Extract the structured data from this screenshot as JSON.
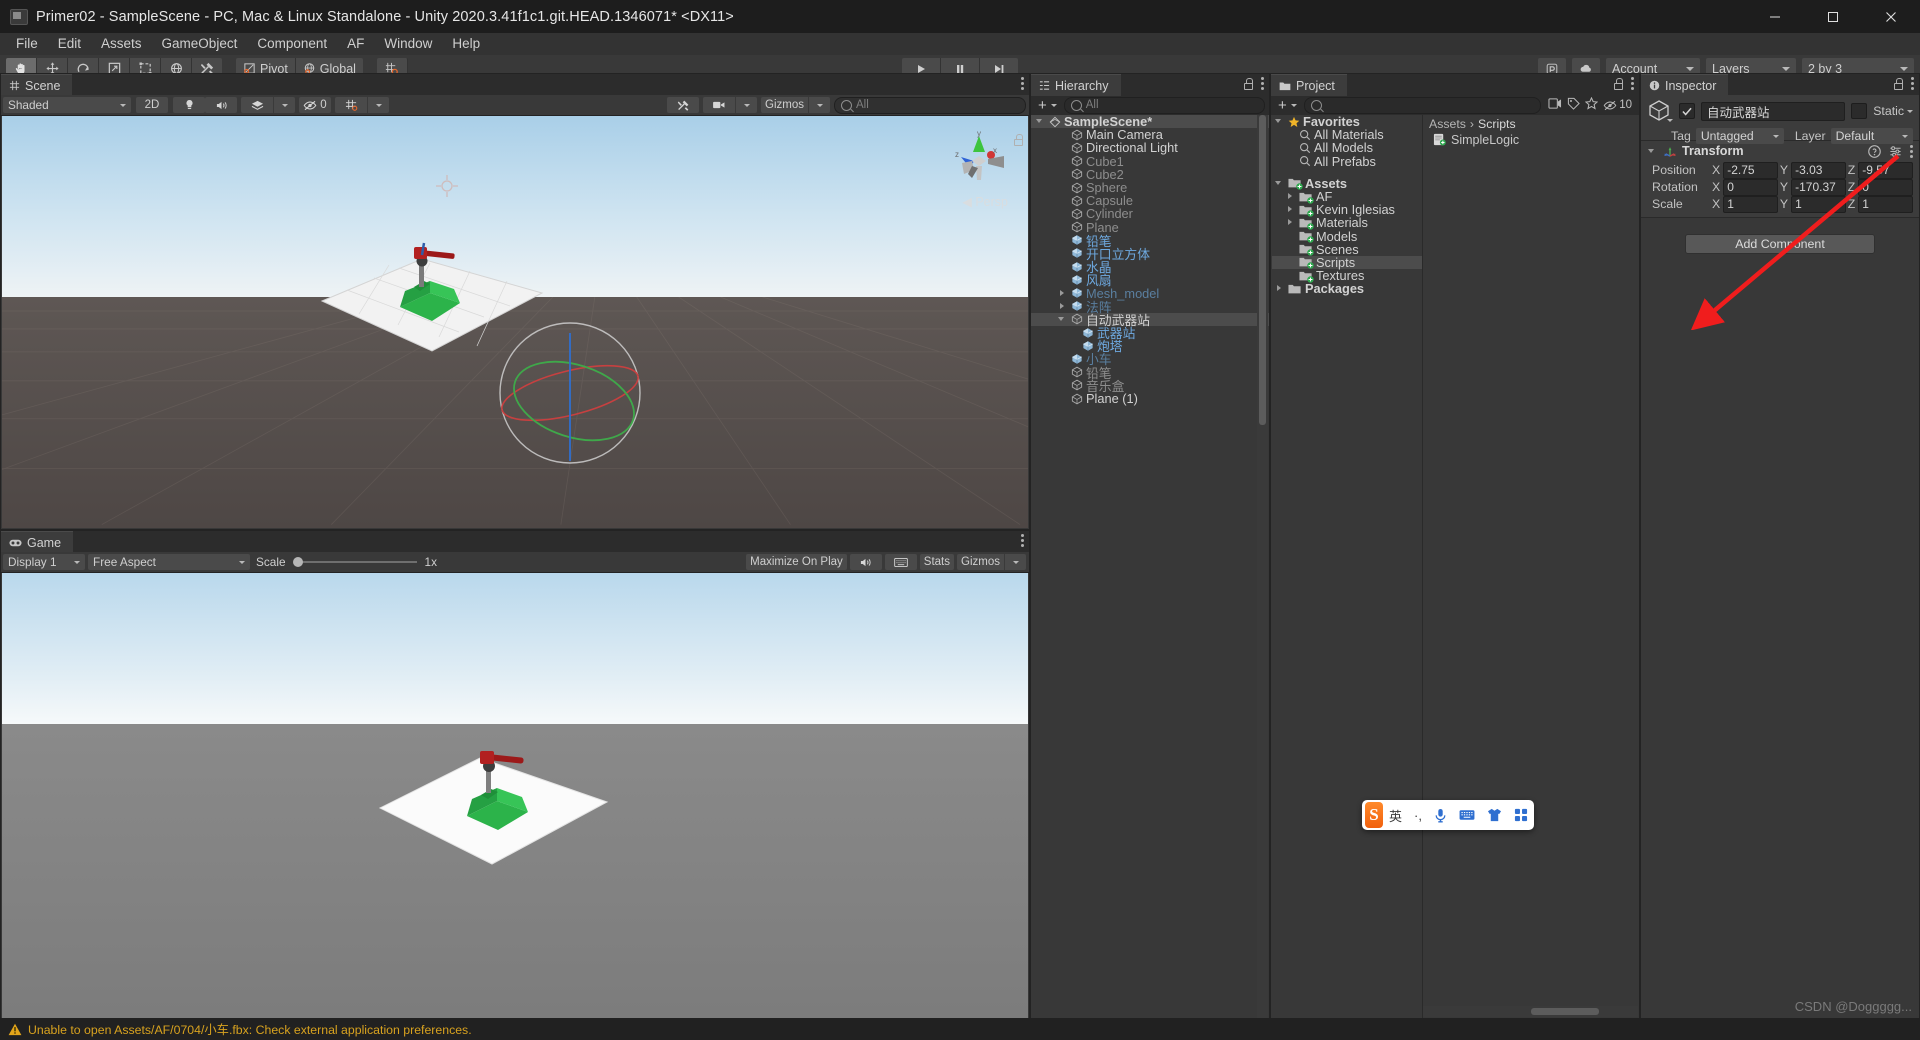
{
  "window": {
    "title": "Primer02 - SampleScene - PC, Mac & Linux Standalone - Unity 2020.3.41f1c1.git.HEAD.1346071* <DX11>",
    "icon": "unity-icon",
    "minimize": "minimize-button",
    "maximize": "maximize-button",
    "close": "close-button"
  },
  "menubar": {
    "items": [
      "File",
      "Edit",
      "Assets",
      "GameObject",
      "Component",
      "AF",
      "Window",
      "Help"
    ]
  },
  "toolbar": {
    "tools": [
      {
        "name": "hand-tool",
        "icon": "hand"
      },
      {
        "name": "move-tool",
        "icon": "move"
      },
      {
        "name": "rotate-tool",
        "icon": "rotate"
      },
      {
        "name": "scale-tool",
        "icon": "scale"
      },
      {
        "name": "rect-tool",
        "icon": "rect"
      },
      {
        "name": "transform-tool",
        "icon": "transform"
      },
      {
        "name": "custom-tool",
        "icon": "wrench"
      }
    ],
    "active_tool": "hand-tool",
    "pivot_label": "Pivot",
    "handle_label": "Global",
    "snap_icon": "grid-snap-icon",
    "play": "play-button",
    "pause": "pause-button",
    "step": "step-button",
    "collab_icon": "collab-icon",
    "cloud_icon": "cloud-icon",
    "account_label": "Account",
    "layers_label": "Layers",
    "layout_label": "2 by 3"
  },
  "scene_panel": {
    "tab_label": "Scene",
    "tab_icon": "scene-grid-icon",
    "shading_mode": "Shaded",
    "two_d_label": "2D",
    "lighting_icon": "light-bulb-icon",
    "audio_icon": "audio-icon",
    "fx_icon": "fx-icon",
    "hidden_count": "0",
    "grid_icon": "grid-icon",
    "tool_icon": "wrench-icon",
    "camera_icon": "camera-icon",
    "gizmos_label": "Gizmos",
    "search_placeholder": "All",
    "gizmo_axes": {
      "x": "x",
      "y": "y",
      "z": "z"
    },
    "persp_label": "Persp"
  },
  "game_panel": {
    "tab_label": "Game",
    "tab_icon": "gamepad-icon",
    "display_label": "Display 1",
    "aspect_label": "Free Aspect",
    "scale_label": "Scale",
    "scale_value": "1x",
    "maximize_label": "Maximize On Play",
    "mute_icon": "audio-icon",
    "stats_label": "Stats",
    "gizmos_label": "Gizmos"
  },
  "hierarchy": {
    "tab_label": "Hierarchy",
    "tab_icon": "hierarchy-icon",
    "search_placeholder": "All",
    "scene_name": "SampleScene*",
    "items": [
      {
        "label": "Main Camera",
        "depth": 2,
        "icon": "gameobject-icon",
        "style": "white",
        "arrow": "none"
      },
      {
        "label": "Directional Light",
        "depth": 2,
        "icon": "gameobject-icon",
        "style": "white",
        "arrow": "none"
      },
      {
        "label": "Cube1",
        "depth": 2,
        "icon": "gameobject-icon",
        "style": "dim",
        "arrow": "none"
      },
      {
        "label": "Cube2",
        "depth": 2,
        "icon": "gameobject-icon",
        "style": "dim",
        "arrow": "none"
      },
      {
        "label": "Sphere",
        "depth": 2,
        "icon": "gameobject-icon",
        "style": "dim",
        "arrow": "none"
      },
      {
        "label": "Capsule",
        "depth": 2,
        "icon": "gameobject-icon",
        "style": "dim",
        "arrow": "none"
      },
      {
        "label": "Cylinder",
        "depth": 2,
        "icon": "gameobject-icon",
        "style": "dim",
        "arrow": "none"
      },
      {
        "label": "Plane",
        "depth": 2,
        "icon": "gameobject-icon",
        "style": "dim",
        "arrow": "none"
      },
      {
        "label": "铅笔",
        "depth": 2,
        "icon": "prefab-icon",
        "style": "blue",
        "arrow": "none"
      },
      {
        "label": "开口立方体",
        "depth": 2,
        "icon": "prefab-icon",
        "style": "blue",
        "arrow": "none"
      },
      {
        "label": "水晶",
        "depth": 2,
        "icon": "prefab-icon",
        "style": "blue",
        "arrow": "none"
      },
      {
        "label": "风扇",
        "depth": 2,
        "icon": "prefab-icon",
        "style": "blue",
        "arrow": "none"
      },
      {
        "label": "Mesh_model",
        "depth": 2,
        "icon": "prefab-icon",
        "style": "bluedim",
        "arrow": "right"
      },
      {
        "label": "法阵",
        "depth": 2,
        "icon": "prefab-icon",
        "style": "bluedim",
        "arrow": "right"
      },
      {
        "label": "自动武器站",
        "depth": 2,
        "icon": "gameobject-icon",
        "style": "white",
        "arrow": "down",
        "selected": true
      },
      {
        "label": "武器站",
        "depth": 3,
        "icon": "prefab-icon",
        "style": "blue",
        "arrow": "none"
      },
      {
        "label": "炮塔",
        "depth": 3,
        "icon": "prefab-icon",
        "style": "blue",
        "arrow": "none"
      },
      {
        "label": "小车",
        "depth": 2,
        "icon": "prefab-icon",
        "style": "bluedim",
        "arrow": "none"
      },
      {
        "label": "铅笔",
        "depth": 2,
        "icon": "gameobject-icon",
        "style": "dim",
        "arrow": "none"
      },
      {
        "label": "音乐盒",
        "depth": 2,
        "icon": "gameobject-icon",
        "style": "dim",
        "arrow": "none"
      },
      {
        "label": "Plane (1)",
        "depth": 2,
        "icon": "gameobject-icon",
        "style": "white",
        "arrow": "none"
      }
    ]
  },
  "project": {
    "tab_label": "Project",
    "tab_icon": "folder-icon",
    "search_placeholder": "",
    "tree": [
      {
        "label": "Favorites",
        "depth": 0,
        "icon": "star-icon",
        "arrow": "down",
        "bold": true
      },
      {
        "label": "All Materials",
        "depth": 1,
        "icon": "search-icon",
        "arrow": "none"
      },
      {
        "label": "All Models",
        "depth": 1,
        "icon": "search-icon",
        "arrow": "none"
      },
      {
        "label": "All Prefabs",
        "depth": 1,
        "icon": "search-icon",
        "arrow": "none"
      },
      {
        "label": "",
        "depth": 0,
        "icon": "spacer",
        "arrow": "none"
      },
      {
        "label": "Assets",
        "depth": 0,
        "icon": "folder-assets-icon",
        "arrow": "down",
        "bold": true
      },
      {
        "label": "AF",
        "depth": 1,
        "icon": "folder-icon",
        "arrow": "right"
      },
      {
        "label": "Kevin Iglesias",
        "depth": 1,
        "icon": "folder-icon",
        "arrow": "right"
      },
      {
        "label": "Materials",
        "depth": 1,
        "icon": "folder-icon",
        "arrow": "right"
      },
      {
        "label": "Models",
        "depth": 1,
        "icon": "folder-icon",
        "arrow": "none"
      },
      {
        "label": "Scenes",
        "depth": 1,
        "icon": "folder-icon",
        "arrow": "none"
      },
      {
        "label": "Scripts",
        "depth": 1,
        "icon": "folder-icon",
        "arrow": "none",
        "selected": true
      },
      {
        "label": "Textures",
        "depth": 1,
        "icon": "folder-icon",
        "arrow": "none"
      },
      {
        "label": "Packages",
        "depth": 0,
        "icon": "folder-packages-icon",
        "arrow": "right",
        "bold": true
      }
    ],
    "breadcrumb": [
      "Assets",
      "Scripts"
    ],
    "files": [
      {
        "label": "SimpleLogic",
        "icon": "cs-script-icon"
      }
    ]
  },
  "inspector": {
    "tab_label": "Inspector",
    "tab_icon": "info-icon",
    "object_icon": "gameobject-icon",
    "enabled": true,
    "object_name": "自动武器站",
    "static_label": "Static",
    "static_checked": false,
    "tag_label": "Tag",
    "tag_value": "Untagged",
    "layer_label": "Layer",
    "layer_value": "Default",
    "transform": {
      "title": "Transform",
      "icon": "transform-icon",
      "help_icon": "help-icon",
      "preset_icon": "preset-icon",
      "menu_icon": "kebab-icon",
      "rows": [
        {
          "label": "Position",
          "x": "-2.75",
          "y": "-3.03",
          "z": "-9.57"
        },
        {
          "label": "Rotation",
          "x": "0",
          "y": "-170.37",
          "z": "0"
        },
        {
          "label": "Scale",
          "x": "1",
          "y": "1",
          "z": "1"
        }
      ]
    },
    "add_component_label": "Add Component"
  },
  "statusbar": {
    "icon": "warning-icon",
    "message": "Unable to open Assets/AF/0704/小车.fbx: Check external application preferences.",
    "color": "#d8a21f"
  },
  "ime_toolbar": {
    "logo": "sogou-logo",
    "logo_char": "S",
    "items": [
      "英",
      "·,",
      "mic-icon",
      "keyboard-icon",
      "skin-icon",
      "apps-icon"
    ],
    "lang_label": "英",
    "punct_label": "·,"
  },
  "annotation": {
    "arrow_color": "#f01d1d",
    "name": "red-arrow-annotation"
  },
  "watermark": "CSDN @Doggggg..."
}
